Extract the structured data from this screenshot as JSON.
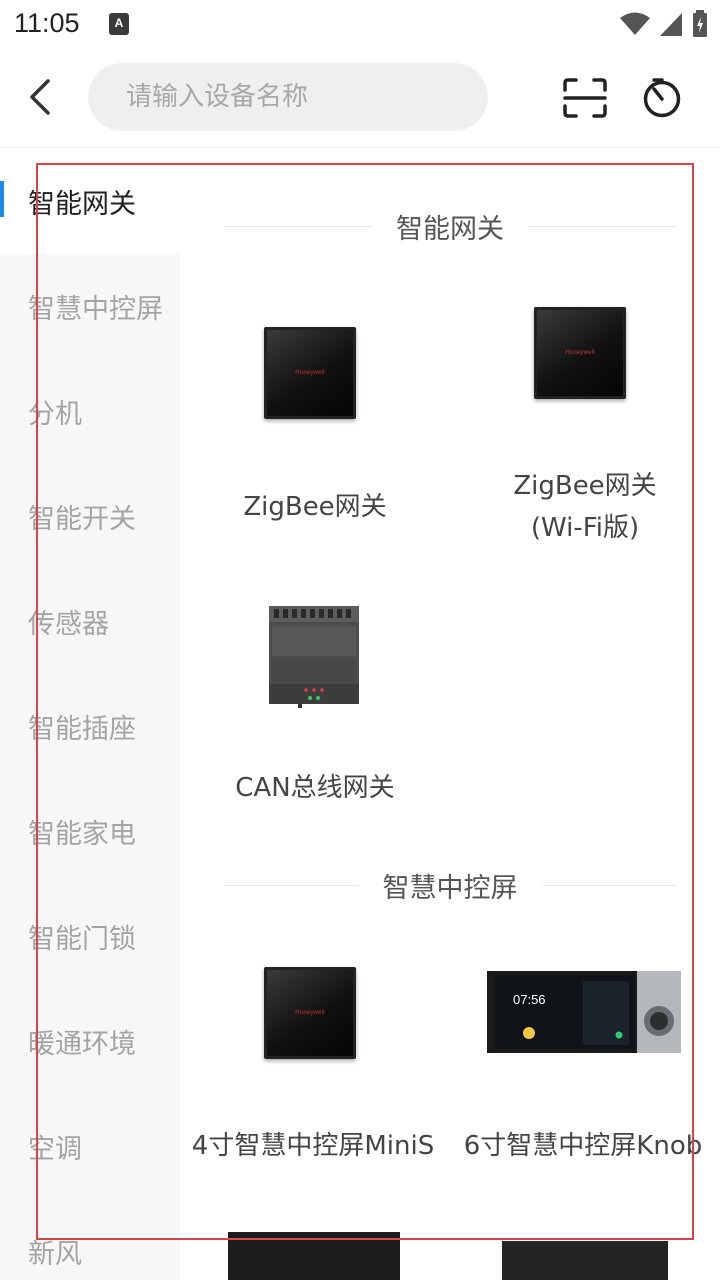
{
  "status_bar": {
    "time": "11:05",
    "app_icon": "A",
    "icons": [
      "wifi-icon",
      "cell-signal-icon",
      "battery-icon"
    ]
  },
  "header": {
    "search_placeholder": "请输入设备名称",
    "back_icon": "chevron-left-icon",
    "scan_icon": "scan-icon",
    "timer_icon": "timer-icon"
  },
  "sidebar": {
    "active_index": 0,
    "accent_color": "#1e88e5",
    "items": [
      {
        "label": "智能网关"
      },
      {
        "label": "智慧中控屏"
      },
      {
        "label": "分机"
      },
      {
        "label": "智能开关"
      },
      {
        "label": "传感器"
      },
      {
        "label": "智能插座"
      },
      {
        "label": "智能家电"
      },
      {
        "label": "智能门锁"
      },
      {
        "label": "暖通环境"
      },
      {
        "label": "空调"
      },
      {
        "label": "新风"
      }
    ]
  },
  "sections": [
    {
      "title": "智能网关",
      "products": [
        {
          "name": "ZigBee网关",
          "image": "black-square-panel"
        },
        {
          "name": "ZigBee网关\n(Wi-Fi版)",
          "image": "black-square-panel"
        },
        {
          "name": "CAN总线网关",
          "image": "din-rail-module"
        }
      ]
    },
    {
      "title": "智慧中控屏",
      "products": [
        {
          "name": "4寸智慧中控屏MiniS",
          "image": "black-square-panel"
        },
        {
          "name": "6寸智慧中控屏Knob",
          "image": "wide-screen-with-knob",
          "screen_time": "07:56"
        }
      ]
    }
  ],
  "panel_logo_text": "Honeywell"
}
